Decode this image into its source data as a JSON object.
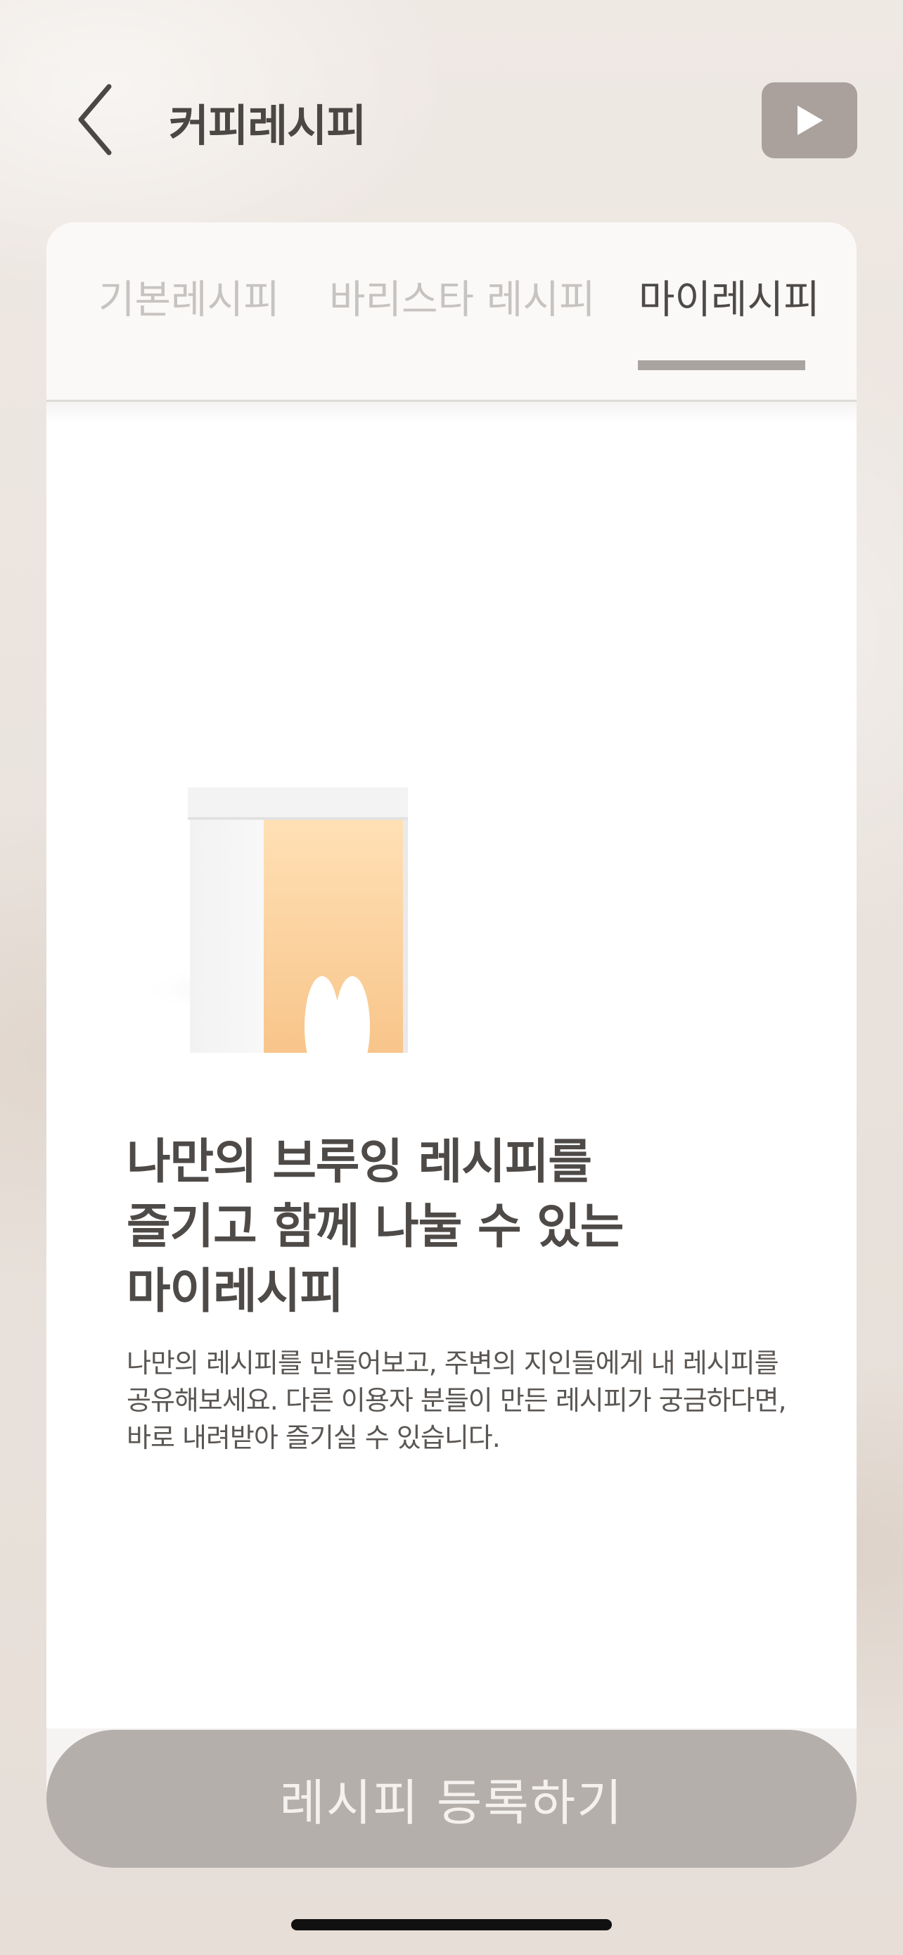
{
  "header": {
    "title": "커피레시피",
    "back_icon": "chevron-left-icon",
    "play_icon": "play-icon"
  },
  "tabs": [
    {
      "label": "기본레시피",
      "active": false
    },
    {
      "label": "바리스타 레시피",
      "active": false
    },
    {
      "label": "마이레시피",
      "active": true
    }
  ],
  "content": {
    "illustration": "coffee-bag-with-beans-icon",
    "headline_lines": [
      "나만의 브루잉 레시피를",
      "즐기고 함께 나눌 수 있는",
      "마이레시피"
    ],
    "description_lines": [
      "나만의 레시피를 만들어보고, 주변의 지인들에게 내 레시피를",
      "공유해보세요. 다른 이용자 분들이 만든 레시피가 궁금하다면,",
      "바로 내려받아 즐기실 수 있습니다."
    ]
  },
  "footer": {
    "register_label": "레시피 등록하기"
  },
  "colors": {
    "accent_orange": "#f7be7f",
    "button_gray": "#b5afac",
    "title_text": "#4b4745"
  }
}
